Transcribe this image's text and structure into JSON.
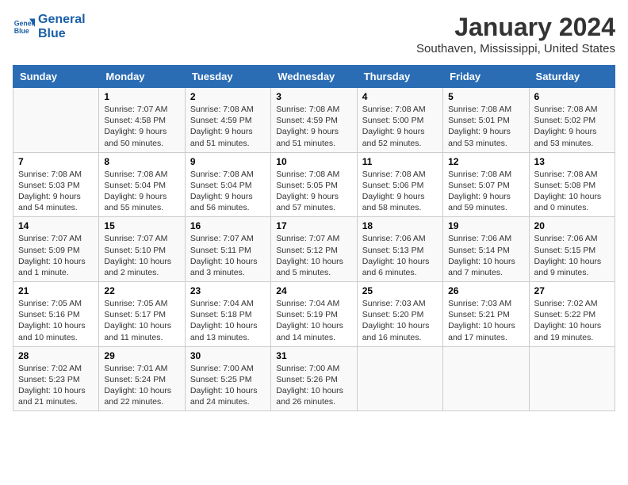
{
  "logo": {
    "line1": "General",
    "line2": "Blue"
  },
  "title": "January 2024",
  "subtitle": "Southaven, Mississippi, United States",
  "weekdays": [
    "Sunday",
    "Monday",
    "Tuesday",
    "Wednesday",
    "Thursday",
    "Friday",
    "Saturday"
  ],
  "weeks": [
    [
      {
        "day": "",
        "info": ""
      },
      {
        "day": "1",
        "info": "Sunrise: 7:07 AM\nSunset: 4:58 PM\nDaylight: 9 hours\nand 50 minutes."
      },
      {
        "day": "2",
        "info": "Sunrise: 7:08 AM\nSunset: 4:59 PM\nDaylight: 9 hours\nand 51 minutes."
      },
      {
        "day": "3",
        "info": "Sunrise: 7:08 AM\nSunset: 4:59 PM\nDaylight: 9 hours\nand 51 minutes."
      },
      {
        "day": "4",
        "info": "Sunrise: 7:08 AM\nSunset: 5:00 PM\nDaylight: 9 hours\nand 52 minutes."
      },
      {
        "day": "5",
        "info": "Sunrise: 7:08 AM\nSunset: 5:01 PM\nDaylight: 9 hours\nand 53 minutes."
      },
      {
        "day": "6",
        "info": "Sunrise: 7:08 AM\nSunset: 5:02 PM\nDaylight: 9 hours\nand 53 minutes."
      }
    ],
    [
      {
        "day": "7",
        "info": "Sunrise: 7:08 AM\nSunset: 5:03 PM\nDaylight: 9 hours\nand 54 minutes."
      },
      {
        "day": "8",
        "info": "Sunrise: 7:08 AM\nSunset: 5:04 PM\nDaylight: 9 hours\nand 55 minutes."
      },
      {
        "day": "9",
        "info": "Sunrise: 7:08 AM\nSunset: 5:04 PM\nDaylight: 9 hours\nand 56 minutes."
      },
      {
        "day": "10",
        "info": "Sunrise: 7:08 AM\nSunset: 5:05 PM\nDaylight: 9 hours\nand 57 minutes."
      },
      {
        "day": "11",
        "info": "Sunrise: 7:08 AM\nSunset: 5:06 PM\nDaylight: 9 hours\nand 58 minutes."
      },
      {
        "day": "12",
        "info": "Sunrise: 7:08 AM\nSunset: 5:07 PM\nDaylight: 9 hours\nand 59 minutes."
      },
      {
        "day": "13",
        "info": "Sunrise: 7:08 AM\nSunset: 5:08 PM\nDaylight: 10 hours\nand 0 minutes."
      }
    ],
    [
      {
        "day": "14",
        "info": "Sunrise: 7:07 AM\nSunset: 5:09 PM\nDaylight: 10 hours\nand 1 minute."
      },
      {
        "day": "15",
        "info": "Sunrise: 7:07 AM\nSunset: 5:10 PM\nDaylight: 10 hours\nand 2 minutes."
      },
      {
        "day": "16",
        "info": "Sunrise: 7:07 AM\nSunset: 5:11 PM\nDaylight: 10 hours\nand 3 minutes."
      },
      {
        "day": "17",
        "info": "Sunrise: 7:07 AM\nSunset: 5:12 PM\nDaylight: 10 hours\nand 5 minutes."
      },
      {
        "day": "18",
        "info": "Sunrise: 7:06 AM\nSunset: 5:13 PM\nDaylight: 10 hours\nand 6 minutes."
      },
      {
        "day": "19",
        "info": "Sunrise: 7:06 AM\nSunset: 5:14 PM\nDaylight: 10 hours\nand 7 minutes."
      },
      {
        "day": "20",
        "info": "Sunrise: 7:06 AM\nSunset: 5:15 PM\nDaylight: 10 hours\nand 9 minutes."
      }
    ],
    [
      {
        "day": "21",
        "info": "Sunrise: 7:05 AM\nSunset: 5:16 PM\nDaylight: 10 hours\nand 10 minutes."
      },
      {
        "day": "22",
        "info": "Sunrise: 7:05 AM\nSunset: 5:17 PM\nDaylight: 10 hours\nand 11 minutes."
      },
      {
        "day": "23",
        "info": "Sunrise: 7:04 AM\nSunset: 5:18 PM\nDaylight: 10 hours\nand 13 minutes."
      },
      {
        "day": "24",
        "info": "Sunrise: 7:04 AM\nSunset: 5:19 PM\nDaylight: 10 hours\nand 14 minutes."
      },
      {
        "day": "25",
        "info": "Sunrise: 7:03 AM\nSunset: 5:20 PM\nDaylight: 10 hours\nand 16 minutes."
      },
      {
        "day": "26",
        "info": "Sunrise: 7:03 AM\nSunset: 5:21 PM\nDaylight: 10 hours\nand 17 minutes."
      },
      {
        "day": "27",
        "info": "Sunrise: 7:02 AM\nSunset: 5:22 PM\nDaylight: 10 hours\nand 19 minutes."
      }
    ],
    [
      {
        "day": "28",
        "info": "Sunrise: 7:02 AM\nSunset: 5:23 PM\nDaylight: 10 hours\nand 21 minutes."
      },
      {
        "day": "29",
        "info": "Sunrise: 7:01 AM\nSunset: 5:24 PM\nDaylight: 10 hours\nand 22 minutes."
      },
      {
        "day": "30",
        "info": "Sunrise: 7:00 AM\nSunset: 5:25 PM\nDaylight: 10 hours\nand 24 minutes."
      },
      {
        "day": "31",
        "info": "Sunrise: 7:00 AM\nSunset: 5:26 PM\nDaylight: 10 hours\nand 26 minutes."
      },
      {
        "day": "",
        "info": ""
      },
      {
        "day": "",
        "info": ""
      },
      {
        "day": "",
        "info": ""
      }
    ]
  ]
}
